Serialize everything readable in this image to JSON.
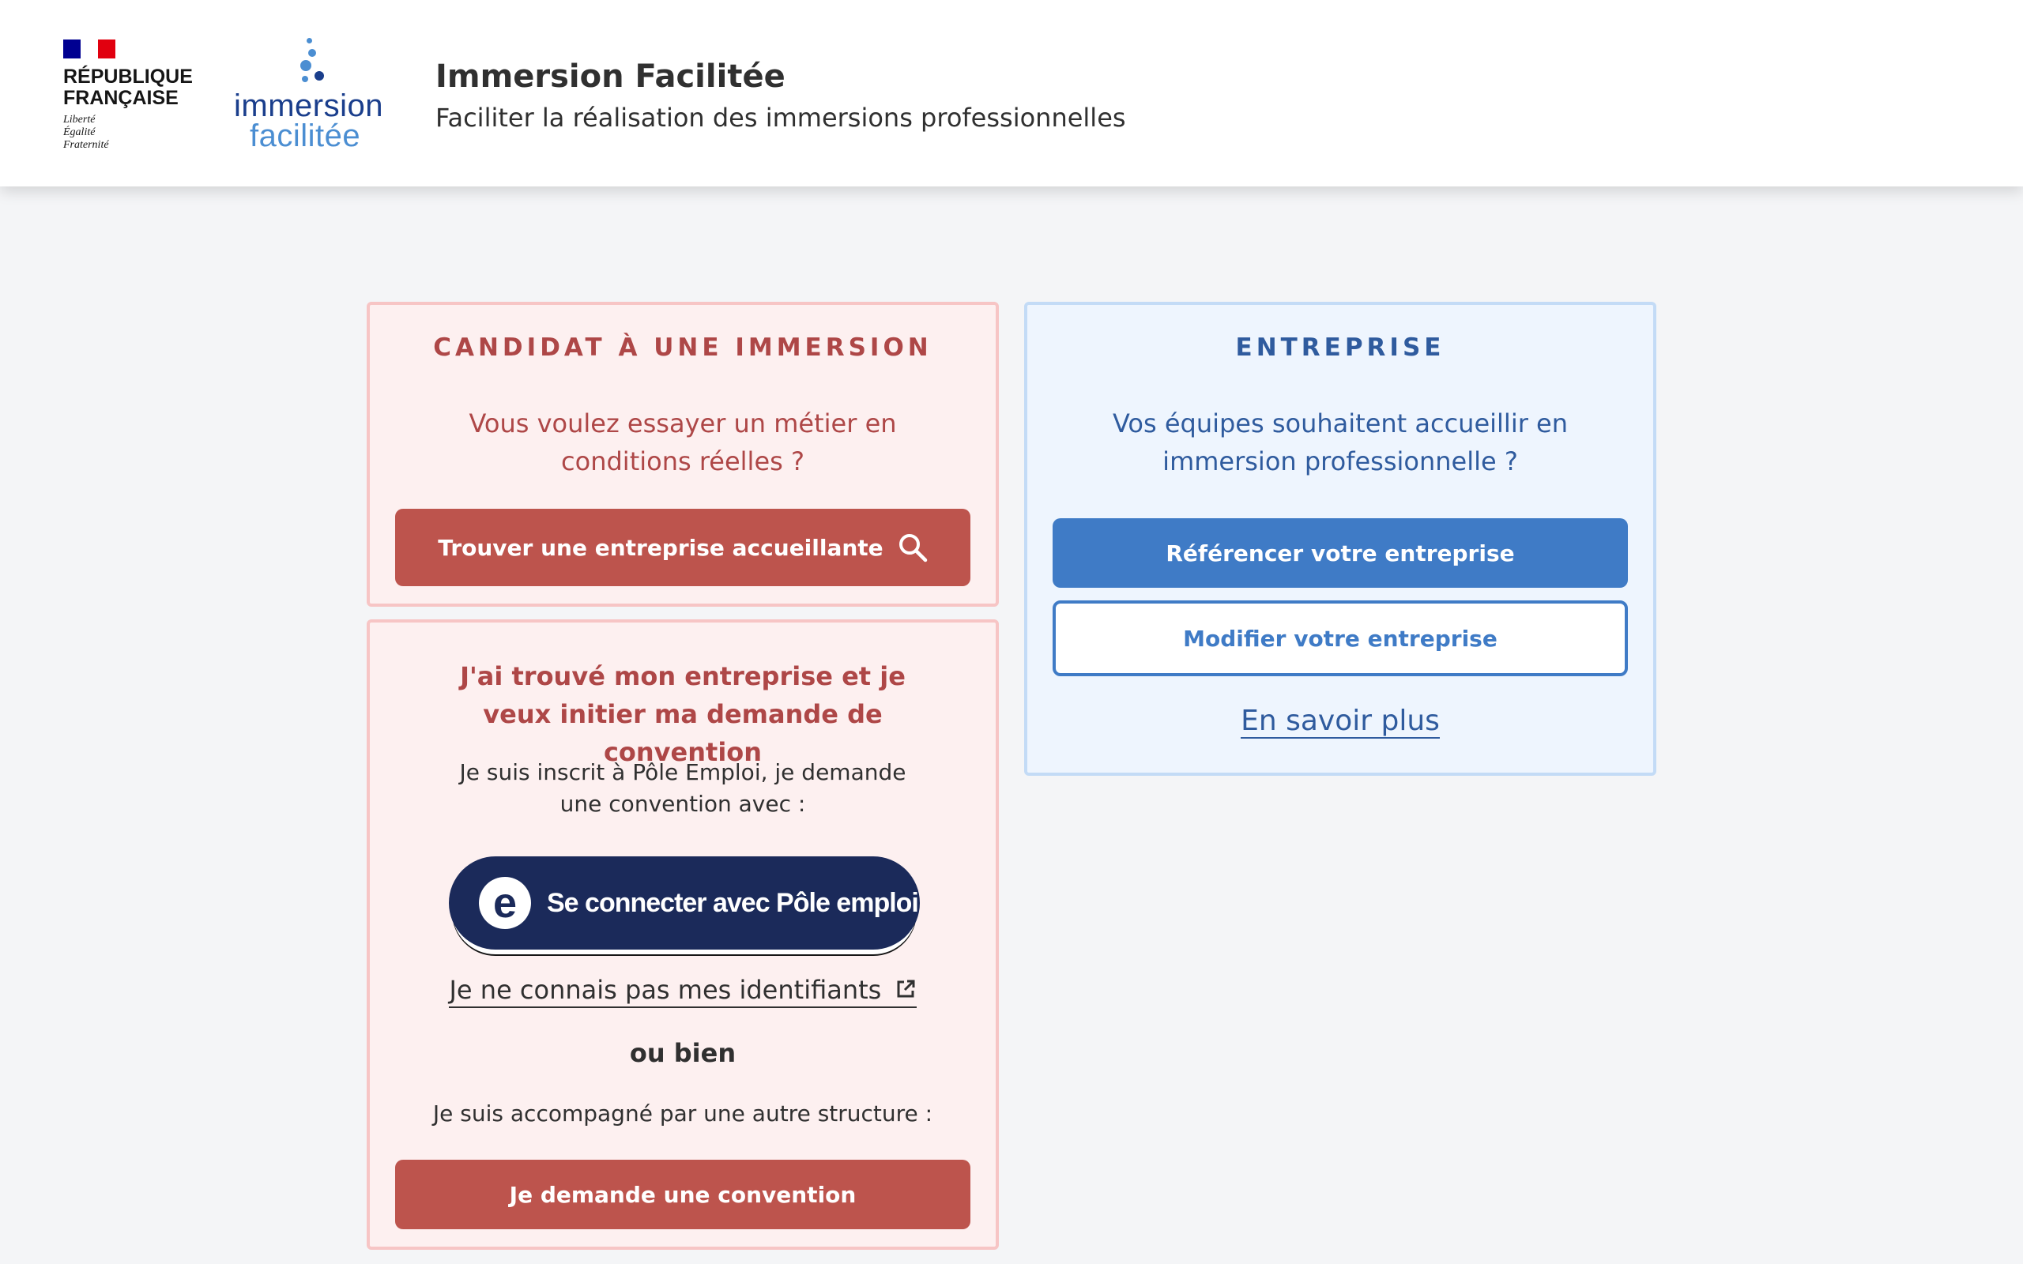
{
  "header": {
    "republic": [
      "RÉPUBLIQUE",
      "FRANÇAISE"
    ],
    "motto": [
      "Liberté",
      "Égalité",
      "Fraternité"
    ],
    "logo_line1": "immersion",
    "logo_line2": "facilitée",
    "title": "Immersion Facilitée",
    "tagline": "Faciliter la réalisation des immersions professionnelles"
  },
  "candidate": {
    "title": "CANDIDAT À UNE IMMERSION",
    "subtitle": "Vous voulez essayer un métier en conditions réelles ?",
    "search_button": "Trouver une entreprise accueillante",
    "search_icon": "search-icon"
  },
  "convention": {
    "title": "J'ai trouvé mon entreprise et je veux initier ma demande de convention",
    "pe_intro": "Je suis inscrit à Pôle Emploi, je demande une convention avec :",
    "pe_button": "Se connecter avec Pôle emploi",
    "pe_logo_letter": "e",
    "forgot_link": "Je ne connais pas mes identifiants",
    "external_icon": "external-link-icon",
    "or_text": "ou bien",
    "other_intro": "Je suis accompagné par une autre structure :",
    "request_button": "Je demande une convention"
  },
  "business": {
    "title": "ENTREPRISE",
    "subtitle": "Vos équipes souhaitent accueillir en immersion professionnelle ?",
    "register_button": "Référencer votre entreprise",
    "edit_button": "Modifier votre entreprise",
    "more_link": "En savoir plus"
  },
  "colors": {
    "candidate_accent": "#bd544d",
    "business_accent": "#3f7bc6",
    "pole_emploi_navy": "#1b2a5a"
  }
}
